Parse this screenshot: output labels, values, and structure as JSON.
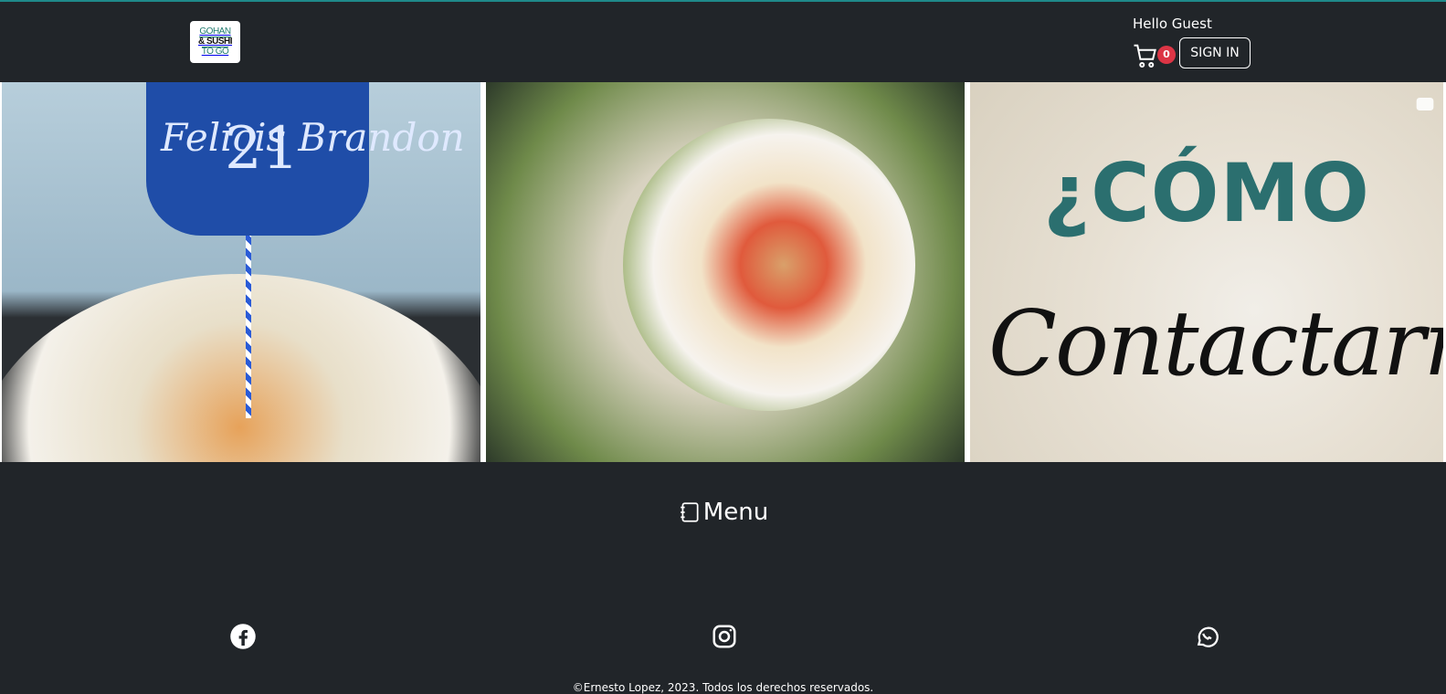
{
  "header": {
    "logo": {
      "line1": "GOHAN",
      "line2": "& SUSHI",
      "line3": "TO GO"
    },
    "greeting": "Hello Guest",
    "cart": {
      "icon": "cart-icon",
      "count": "0"
    },
    "signin_label": "SIGN IN"
  },
  "carousel": {
    "panels": [
      {
        "topper_text": "Felicis Brandon",
        "topper_number": "21"
      },
      {},
      {
        "title": "¿CÓMO",
        "subtitle": "Contactarnos?"
      }
    ]
  },
  "menu": {
    "icon": "journal-icon",
    "label": "Menu"
  },
  "social": {
    "facebook_icon": "facebook-icon",
    "instagram_icon": "instagram-icon",
    "whatsapp_icon": "whatsapp-icon"
  },
  "footer": {
    "copyright": "©Ernesto Lopez, 2023. Todos los derechos reservados."
  },
  "colors": {
    "background": "#212529",
    "accent_topline": "#1f8a8a",
    "cart_badge": "#dc3545"
  }
}
